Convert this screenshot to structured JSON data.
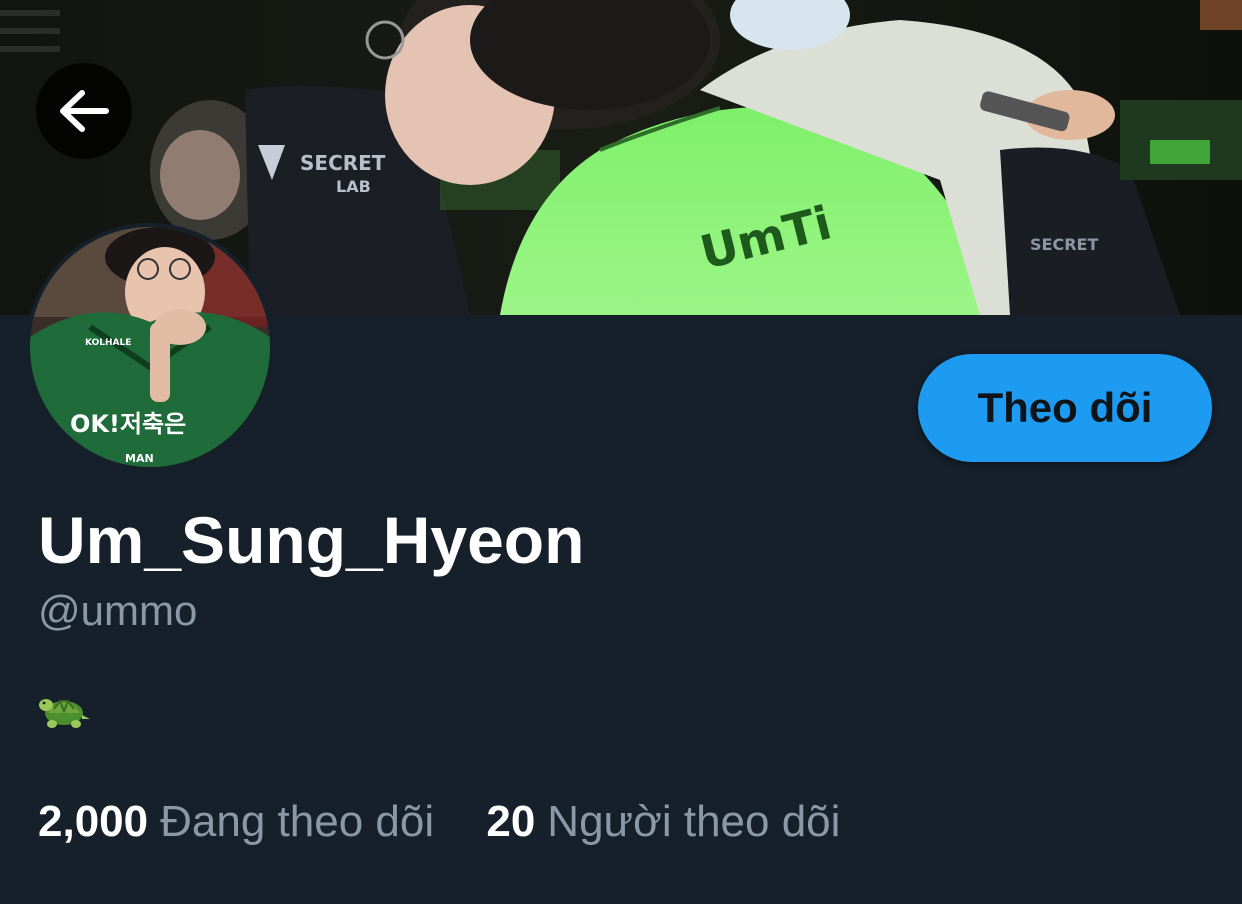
{
  "header": {
    "back_icon": "arrow-left-icon",
    "banner": "cover-photo"
  },
  "profile": {
    "display_name": "Um_Sung_Hyeon",
    "handle": "@ummo",
    "bio_icon": "turtle-emoji",
    "follow_button_label": "Theo dõi",
    "following": {
      "count": "2,000",
      "label": "Đang theo dõi"
    },
    "followers": {
      "count": "20",
      "label": "Người theo dõi"
    }
  },
  "colors": {
    "background": "#15202b",
    "accent": "#1d9bf0",
    "secondary_text": "#8b98a5",
    "primary_text": "#ffffff"
  }
}
